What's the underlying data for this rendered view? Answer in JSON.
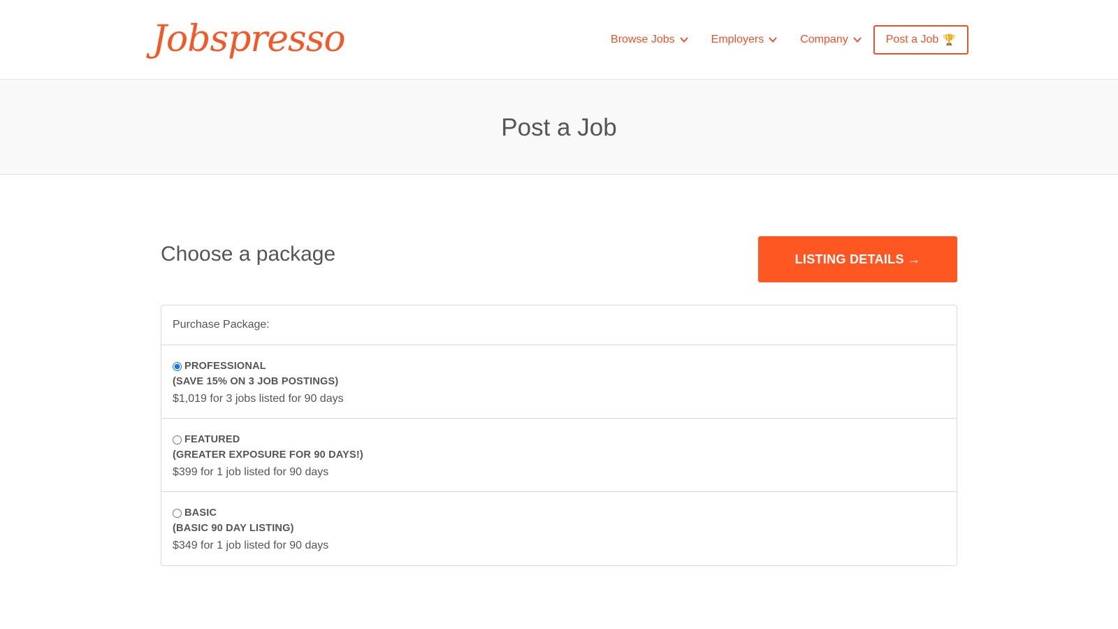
{
  "header": {
    "logo_text": "Jobspresso",
    "nav": [
      {
        "label": "Browse Jobs"
      },
      {
        "label": "Employers"
      },
      {
        "label": "Company"
      }
    ],
    "post_job_label": "Post a Job",
    "post_job_icon": "trophy-icon",
    "accent_color": "#e8542a"
  },
  "banner": {
    "title": "Post a Job"
  },
  "main": {
    "section_title": "Choose a package",
    "cta_label": "LISTING DETAILS →",
    "cta_color": "#fe5722",
    "panel_header": "Purchase Package:",
    "packages": [
      {
        "name": "PROFESSIONAL",
        "subtitle": "(SAVE 15% ON 3 JOB POSTINGS)",
        "price": "$1,019 for 3 jobs listed for 90 days",
        "selected": true
      },
      {
        "name": "FEATURED",
        "subtitle": "(GREATER EXPOSURE FOR 90 DAYS!)",
        "price": "$399 for 1 job listed for 90 days",
        "selected": false
      },
      {
        "name": "BASIC",
        "subtitle": "(BASIC 90 DAY LISTING)",
        "price": "$349 for 1 job listed for 90 days",
        "selected": false
      }
    ]
  }
}
